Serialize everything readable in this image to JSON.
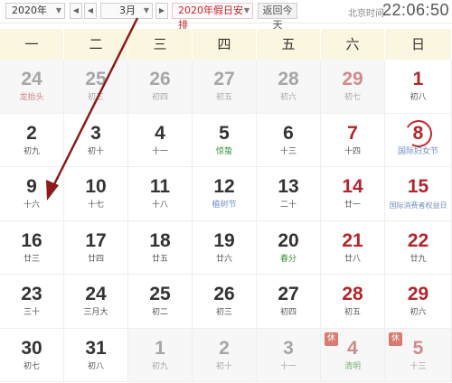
{
  "toolbar": {
    "year": "2020年",
    "month": "3月",
    "holiday_schedule": "2020年假日安排",
    "today_button": "返回今天",
    "beijing_time_label": "北京时间",
    "clock": "22:06:50"
  },
  "weekdays": [
    "一",
    "二",
    "三",
    "四",
    "五",
    "六",
    "日"
  ],
  "weeks": [
    [
      {
        "day": "24",
        "lunar": "龙抬头",
        "style": "festival",
        "dim": true
      },
      {
        "day": "25",
        "lunar": "初三",
        "dim": true
      },
      {
        "day": "26",
        "lunar": "初四",
        "dim": true
      },
      {
        "day": "27",
        "lunar": "初五",
        "dim": true
      },
      {
        "day": "28",
        "lunar": "初六",
        "dim": true
      },
      {
        "day": "29",
        "lunar": "初七",
        "dim": true
      },
      {
        "day": "1",
        "lunar": "初八"
      }
    ],
    [
      {
        "day": "2",
        "lunar": "初九"
      },
      {
        "day": "3",
        "lunar": "初十"
      },
      {
        "day": "4",
        "lunar": "十一"
      },
      {
        "day": "5",
        "lunar": "惊蛰",
        "style": "term"
      },
      {
        "day": "6",
        "lunar": "十三"
      },
      {
        "day": "7",
        "lunar": "十四"
      },
      {
        "day": "8",
        "lunar": "国际妇女节",
        "style": "holiday-name",
        "circled": true
      }
    ],
    [
      {
        "day": "9",
        "lunar": "十六"
      },
      {
        "day": "10",
        "lunar": "十七"
      },
      {
        "day": "11",
        "lunar": "十八"
      },
      {
        "day": "12",
        "lunar": "植树节",
        "style": "holiday-name"
      },
      {
        "day": "13",
        "lunar": "二十"
      },
      {
        "day": "14",
        "lunar": "廿一"
      },
      {
        "day": "15",
        "lunar": "国际消费者权益日",
        "style": "holiday-name"
      }
    ],
    [
      {
        "day": "16",
        "lunar": "廿三"
      },
      {
        "day": "17",
        "lunar": "廿四"
      },
      {
        "day": "18",
        "lunar": "廿五"
      },
      {
        "day": "19",
        "lunar": "廿六"
      },
      {
        "day": "20",
        "lunar": "春分",
        "style": "term"
      },
      {
        "day": "21",
        "lunar": "廿八"
      },
      {
        "day": "22",
        "lunar": "廿九"
      }
    ],
    [
      {
        "day": "23",
        "lunar": "三十"
      },
      {
        "day": "24",
        "lunar": "三月大"
      },
      {
        "day": "25",
        "lunar": "初二"
      },
      {
        "day": "26",
        "lunar": "初三"
      },
      {
        "day": "27",
        "lunar": "初四"
      },
      {
        "day": "28",
        "lunar": "初五"
      },
      {
        "day": "29",
        "lunar": "初六"
      }
    ],
    [
      {
        "day": "30",
        "lunar": "初七"
      },
      {
        "day": "31",
        "lunar": "初八"
      },
      {
        "day": "1",
        "lunar": "初九",
        "dim": true
      },
      {
        "day": "2",
        "lunar": "初十",
        "dim": true
      },
      {
        "day": "3",
        "lunar": "十一",
        "dim": true
      },
      {
        "day": "4",
        "lunar": "清明",
        "style": "term",
        "dim": true,
        "badge": "休"
      },
      {
        "day": "5",
        "lunar": "十三",
        "dim": true,
        "badge": "休"
      }
    ]
  ],
  "colors": {
    "accent_red": "#c0282d",
    "weekday_header_bg": "#fbf6df",
    "arrow": "#8b1a1a"
  },
  "icons": {
    "prev": "chevron-left-icon",
    "next": "chevron-right-icon",
    "dropdown": "caret-down-icon"
  }
}
